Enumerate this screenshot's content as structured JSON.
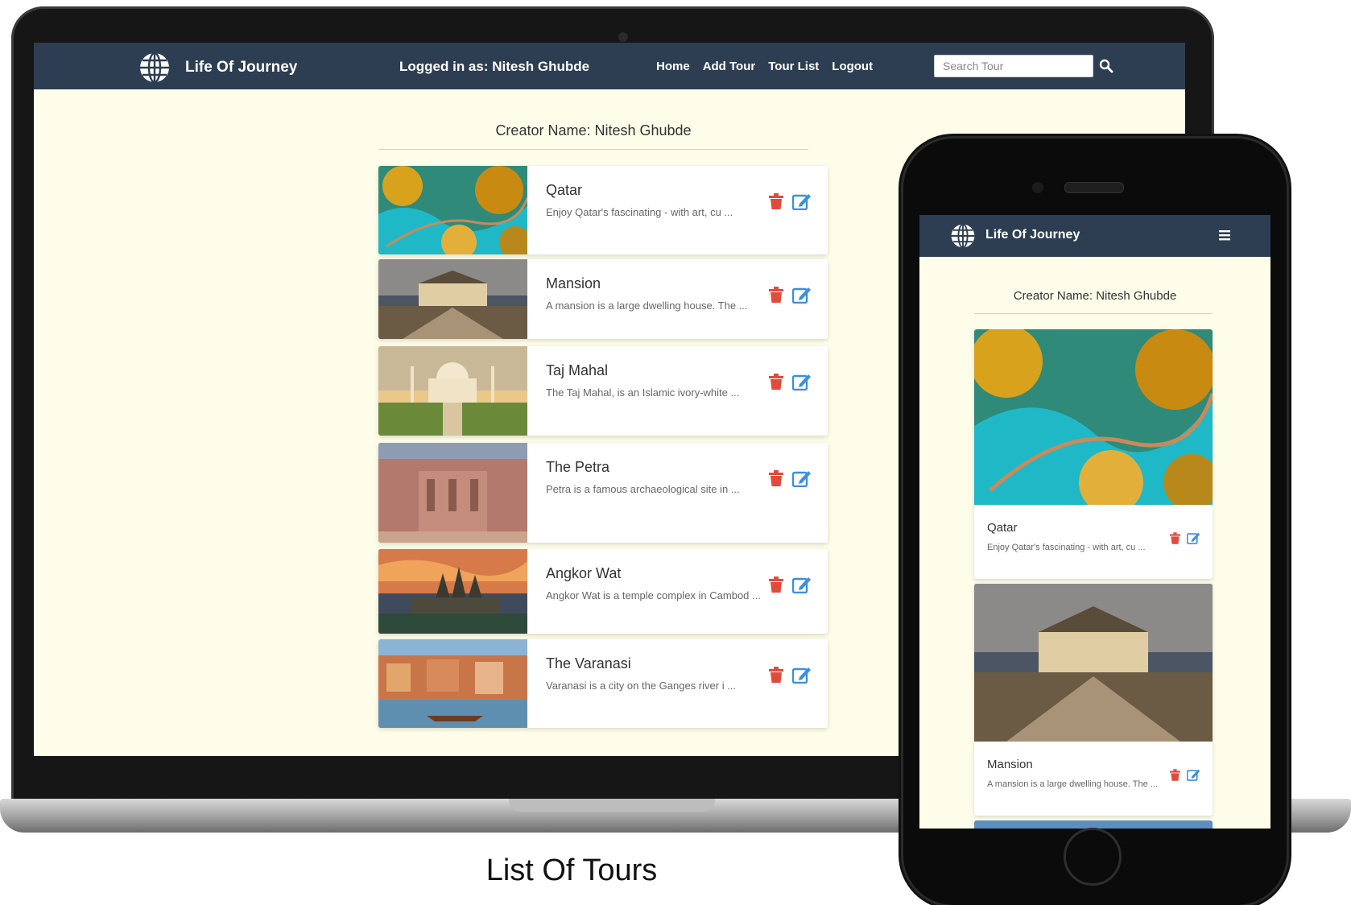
{
  "desktop": {
    "brand": "Life Of Journey",
    "logged_in_text": "Logged in as: Nitesh Ghubde",
    "nav": [
      "Home",
      "Add Tour",
      "Tour List",
      "Logout"
    ],
    "search_placeholder": "Search Tour",
    "creator": "Creator Name: Nitesh Ghubde",
    "tours": [
      {
        "title": "Qatar",
        "desc": "Enjoy Qatar's fascinating - with art, cu ..."
      },
      {
        "title": "Mansion",
        "desc": "A mansion is a large dwelling house. The ..."
      },
      {
        "title": "Taj Mahal",
        "desc": "The Taj Mahal, is an Islamic ivory-white ..."
      },
      {
        "title": "The Petra",
        "desc": "Petra is a famous archaeological site in ..."
      },
      {
        "title": "Angkor Wat",
        "desc": "Angkor Wat is a temple complex in Cambod ..."
      },
      {
        "title": "The Varanasi",
        "desc": "Varanasi is a city on the Ganges river i ..."
      }
    ]
  },
  "mobile": {
    "brand": "Life Of Journey",
    "creator": "Creator Name: Nitesh Ghubde",
    "tours": [
      {
        "title": "Qatar",
        "desc": "Enjoy Qatar's fascinating - with art, cu ..."
      },
      {
        "title": "Mansion",
        "desc": "A mansion is a large dwelling house. The ..."
      }
    ]
  },
  "caption": "List Of Tours",
  "colors": {
    "navbar": "#2e3e52",
    "page_bg": "#fefde9",
    "trash": "#e04b3c",
    "edit": "#3b8fe0"
  },
  "icons": [
    "globe-icon",
    "search-icon",
    "trash-icon",
    "edit-icon",
    "menu-icon"
  ]
}
